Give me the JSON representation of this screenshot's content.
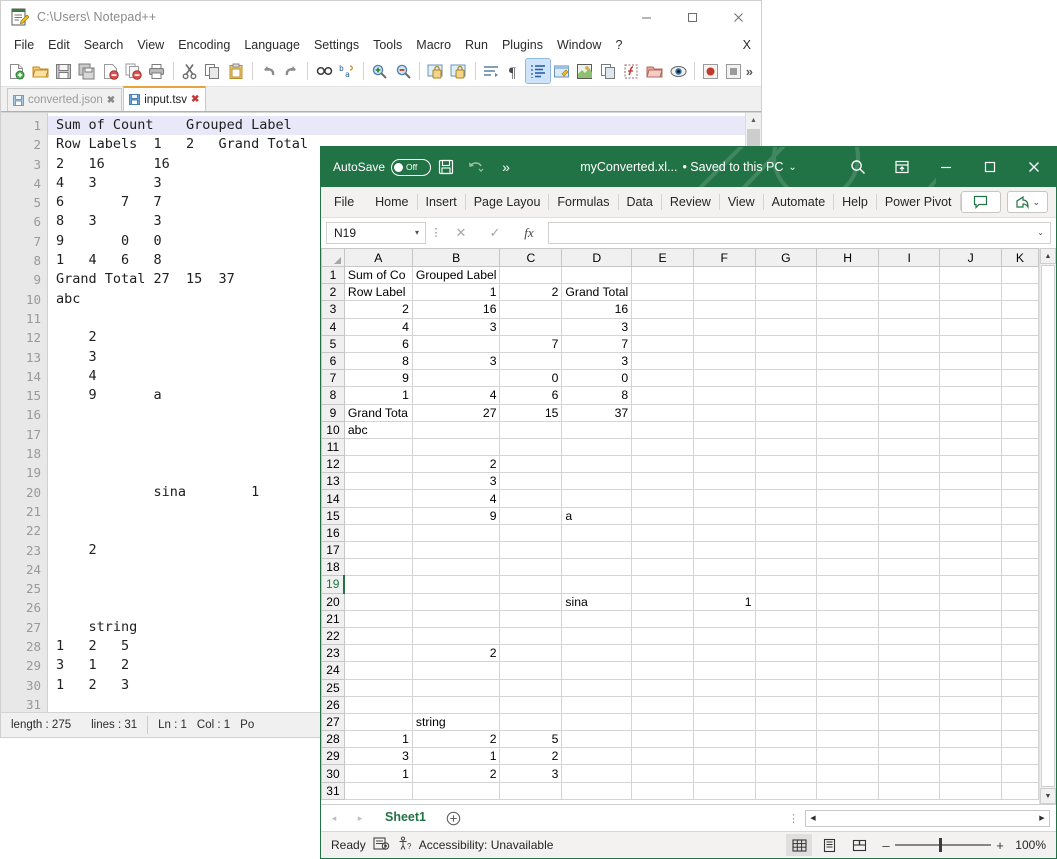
{
  "notepad": {
    "title": "C:\\Users\\ Notepad++",
    "window_buttons": {
      "minimize": "—",
      "maximize": "□",
      "close": "✕"
    },
    "menu": [
      "File",
      "Edit",
      "Search",
      "View",
      "Encoding",
      "Language",
      "Settings",
      "Tools",
      "Macro",
      "Run",
      "Plugins",
      "Window",
      "?"
    ],
    "menu_close": "X",
    "toolbar_icons": [
      "new-file-icon",
      "open-file-icon",
      "save-icon",
      "save-all-icon",
      "close-file-icon",
      "close-all-icon",
      "print-icon",
      "cut-icon",
      "copy-icon",
      "paste-icon",
      "undo-icon",
      "redo-icon",
      "find-icon",
      "replace-icon",
      "zoom-in-icon",
      "zoom-out-icon",
      "sync-vertical-icon",
      "sync-horizontal-icon",
      "word-wrap-icon",
      "all-chars-icon",
      "indent-guide-icon",
      "user-language-icon",
      "doc-map-icon",
      "doc-list-icon",
      "function-list-icon",
      "folder-workspace-icon",
      "monitoring-icon",
      "record-macro-icon",
      "stop-macro-icon"
    ],
    "toolbar_overflow": "»",
    "tabs": [
      {
        "label": "converted.json",
        "active": false,
        "close": "✕"
      },
      {
        "label": "input.tsv",
        "active": true,
        "close": "✕"
      }
    ],
    "lines": [
      {
        "n": 1,
        "text": "Sum of Count    Grouped Label"
      },
      {
        "n": 2,
        "text": "Row Labels  1   2   Grand Total"
      },
      {
        "n": 3,
        "text": "2   16      16"
      },
      {
        "n": 4,
        "text": "4   3       3"
      },
      {
        "n": 5,
        "text": "6       7   7"
      },
      {
        "n": 6,
        "text": "8   3       3"
      },
      {
        "n": 7,
        "text": "9       0   0"
      },
      {
        "n": 8,
        "text": "1   4   6   8"
      },
      {
        "n": 9,
        "text": "Grand Total 27  15  37"
      },
      {
        "n": 10,
        "text": "abc"
      },
      {
        "n": 11,
        "text": ""
      },
      {
        "n": 12,
        "text": "    2"
      },
      {
        "n": 13,
        "text": "    3"
      },
      {
        "n": 14,
        "text": "    4"
      },
      {
        "n": 15,
        "text": "    9       a"
      },
      {
        "n": 16,
        "text": ""
      },
      {
        "n": 17,
        "text": ""
      },
      {
        "n": 18,
        "text": ""
      },
      {
        "n": 19,
        "text": ""
      },
      {
        "n": 20,
        "text": "            sina        1"
      },
      {
        "n": 21,
        "text": ""
      },
      {
        "n": 22,
        "text": ""
      },
      {
        "n": 23,
        "text": "    2"
      },
      {
        "n": 24,
        "text": ""
      },
      {
        "n": 25,
        "text": ""
      },
      {
        "n": 26,
        "text": ""
      },
      {
        "n": 27,
        "text": "    string"
      },
      {
        "n": 28,
        "text": "1   2   5"
      },
      {
        "n": 29,
        "text": "3   1   2"
      },
      {
        "n": 30,
        "text": "1   2   3"
      },
      {
        "n": 31,
        "text": ""
      }
    ],
    "status": {
      "length": "length : 275",
      "lines": "lines : 31",
      "ln": "Ln : 1",
      "col": "Col : 1",
      "pos": "Po"
    }
  },
  "excel": {
    "titlebar": {
      "autosave_label": "AutoSave",
      "autosave_state": "Off",
      "save_icon": "save-icon",
      "undo_icon": "undo-icon",
      "qat_more": "»",
      "document_name": "myConverted.xl...",
      "save_state": "• Saved to this PC",
      "save_state_chevron": "⌄",
      "search_icon": "search-icon",
      "ribbon_display_icon": "ribbon-display-options-icon",
      "minimize": "—",
      "maximize": "□",
      "close": "✕"
    },
    "ribbon_tabs": [
      "File",
      "Home",
      "Insert",
      "Page Layou",
      "Formulas",
      "Data",
      "Review",
      "View",
      "Automate",
      "Help",
      "Power Pivot"
    ],
    "ribbon_right": {
      "comments_icon": "comment-icon",
      "share_icon": "share-icon",
      "share_chevron": "⌄"
    },
    "formula_bar": {
      "name_box": "N19",
      "name_box_chevron": "▾",
      "cancel_icon": "cancel-icon",
      "enter_icon": "enter-icon",
      "function_icon": "fx",
      "formula_value": "",
      "expand_chevron": "⌄"
    },
    "columns": [
      "A",
      "B",
      "C",
      "D",
      "E",
      "F",
      "G",
      "H",
      "I",
      "J",
      "K"
    ],
    "rows": [
      1,
      2,
      3,
      4,
      5,
      6,
      7,
      8,
      9,
      10,
      11,
      12,
      13,
      14,
      15,
      16,
      17,
      18,
      19,
      20,
      21,
      22,
      23,
      24,
      25,
      26,
      27,
      28,
      29,
      30,
      31
    ],
    "active_row": 19,
    "cells": [
      {
        "row": 1,
        "A": "Sum of Co",
        "B": "Grouped Label",
        "C": "",
        "D": "",
        "E": "",
        "F": "",
        "align": {
          "A": "txt",
          "B": "txt"
        }
      },
      {
        "row": 2,
        "A": "Row Label",
        "B": "1",
        "C": "2",
        "D": "Grand Total",
        "E": "",
        "F": "",
        "align": {
          "A": "txt",
          "B": "num",
          "C": "num",
          "D": "txt"
        }
      },
      {
        "row": 3,
        "A": "2",
        "B": "16",
        "C": "",
        "D": "16",
        "E": "",
        "F": "",
        "align": {
          "A": "num",
          "B": "num",
          "D": "num"
        }
      },
      {
        "row": 4,
        "A": "4",
        "B": "3",
        "C": "",
        "D": "3",
        "E": "",
        "F": "",
        "align": {
          "A": "num",
          "B": "num",
          "D": "num"
        }
      },
      {
        "row": 5,
        "A": "6",
        "B": "",
        "C": "7",
        "D": "7",
        "E": "",
        "F": "",
        "align": {
          "A": "num",
          "C": "num",
          "D": "num"
        }
      },
      {
        "row": 6,
        "A": "8",
        "B": "3",
        "C": "",
        "D": "3",
        "E": "",
        "F": "",
        "align": {
          "A": "num",
          "B": "num",
          "D": "num"
        }
      },
      {
        "row": 7,
        "A": "9",
        "B": "",
        "C": "0",
        "D": "0",
        "E": "",
        "F": "",
        "align": {
          "A": "num",
          "C": "num",
          "D": "num"
        }
      },
      {
        "row": 8,
        "A": "1",
        "B": "4",
        "C": "6",
        "D": "8",
        "E": "",
        "F": "",
        "align": {
          "A": "num",
          "B": "num",
          "C": "num",
          "D": "num"
        }
      },
      {
        "row": 9,
        "A": "Grand Tota",
        "B": "27",
        "C": "15",
        "D": "37",
        "E": "",
        "F": "",
        "align": {
          "A": "txt",
          "B": "num",
          "C": "num",
          "D": "num"
        }
      },
      {
        "row": 10,
        "A": "abc",
        "B": "",
        "C": "",
        "D": "",
        "E": "",
        "F": "",
        "align": {
          "A": "txt"
        }
      },
      {
        "row": 11,
        "A": "",
        "B": "",
        "C": "",
        "D": "",
        "E": "",
        "F": ""
      },
      {
        "row": 12,
        "A": "",
        "B": "2",
        "C": "",
        "D": "",
        "E": "",
        "F": "",
        "align": {
          "B": "num"
        }
      },
      {
        "row": 13,
        "A": "",
        "B": "3",
        "C": "",
        "D": "",
        "E": "",
        "F": "",
        "align": {
          "B": "num"
        }
      },
      {
        "row": 14,
        "A": "",
        "B": "4",
        "C": "",
        "D": "",
        "E": "",
        "F": "",
        "align": {
          "B": "num"
        }
      },
      {
        "row": 15,
        "A": "",
        "B": "9",
        "C": "",
        "D": "a",
        "E": "",
        "F": "",
        "align": {
          "B": "num",
          "D": "txt"
        }
      },
      {
        "row": 16,
        "A": "",
        "B": "",
        "C": "",
        "D": "",
        "E": "",
        "F": ""
      },
      {
        "row": 17,
        "A": "",
        "B": "",
        "C": "",
        "D": "",
        "E": "",
        "F": ""
      },
      {
        "row": 18,
        "A": "",
        "B": "",
        "C": "",
        "D": "",
        "E": "",
        "F": ""
      },
      {
        "row": 19,
        "A": "",
        "B": "",
        "C": "",
        "D": "",
        "E": "",
        "F": ""
      },
      {
        "row": 20,
        "A": "",
        "B": "",
        "C": "",
        "D": "sina",
        "E": "",
        "F": "1",
        "align": {
          "D": "txt",
          "F": "num"
        }
      },
      {
        "row": 21,
        "A": "",
        "B": "",
        "C": "",
        "D": "",
        "E": "",
        "F": ""
      },
      {
        "row": 22,
        "A": "",
        "B": "",
        "C": "",
        "D": "",
        "E": "",
        "F": ""
      },
      {
        "row": 23,
        "A": "",
        "B": "2",
        "C": "",
        "D": "",
        "E": "",
        "F": "",
        "align": {
          "B": "num"
        }
      },
      {
        "row": 24,
        "A": "",
        "B": "",
        "C": "",
        "D": "",
        "E": "",
        "F": ""
      },
      {
        "row": 25,
        "A": "",
        "B": "",
        "C": "",
        "D": "",
        "E": "",
        "F": ""
      },
      {
        "row": 26,
        "A": "",
        "B": "",
        "C": "",
        "D": "",
        "E": "",
        "F": ""
      },
      {
        "row": 27,
        "A": "",
        "B": "string",
        "C": "",
        "D": "",
        "E": "",
        "F": "",
        "align": {
          "B": "txt"
        }
      },
      {
        "row": 28,
        "A": "1",
        "B": "2",
        "C": "5",
        "D": "",
        "E": "",
        "F": "",
        "align": {
          "A": "num",
          "B": "num",
          "C": "num"
        }
      },
      {
        "row": 29,
        "A": "3",
        "B": "1",
        "C": "2",
        "D": "",
        "E": "",
        "F": "",
        "align": {
          "A": "num",
          "B": "num",
          "C": "num"
        }
      },
      {
        "row": 30,
        "A": "1",
        "B": "2",
        "C": "3",
        "D": "",
        "E": "",
        "F": "",
        "align": {
          "A": "num",
          "B": "num",
          "C": "num"
        }
      },
      {
        "row": 31,
        "A": "",
        "B": "",
        "C": "",
        "D": "",
        "E": "",
        "F": ""
      }
    ],
    "sheet_tabs": {
      "prev": "◂",
      "next": "▸",
      "name": "Sheet1",
      "add": "+"
    },
    "status": {
      "ready": "Ready",
      "macro_icon": "record-macro-icon",
      "accessibility_icon": "accessibility-icon",
      "accessibility": "Accessibility: Unavailable",
      "view_normal_icon": "normal-view-icon",
      "view_layout_icon": "page-layout-view-icon",
      "view_break_icon": "page-break-view-icon",
      "zoom_minus": "–",
      "zoom_plus": "+",
      "zoom_value": "100%"
    }
  },
  "colors": {
    "excel_green": "#217346",
    "npp_tab_accent": "#e8a33d",
    "selection_line": "#e8e8f8"
  }
}
